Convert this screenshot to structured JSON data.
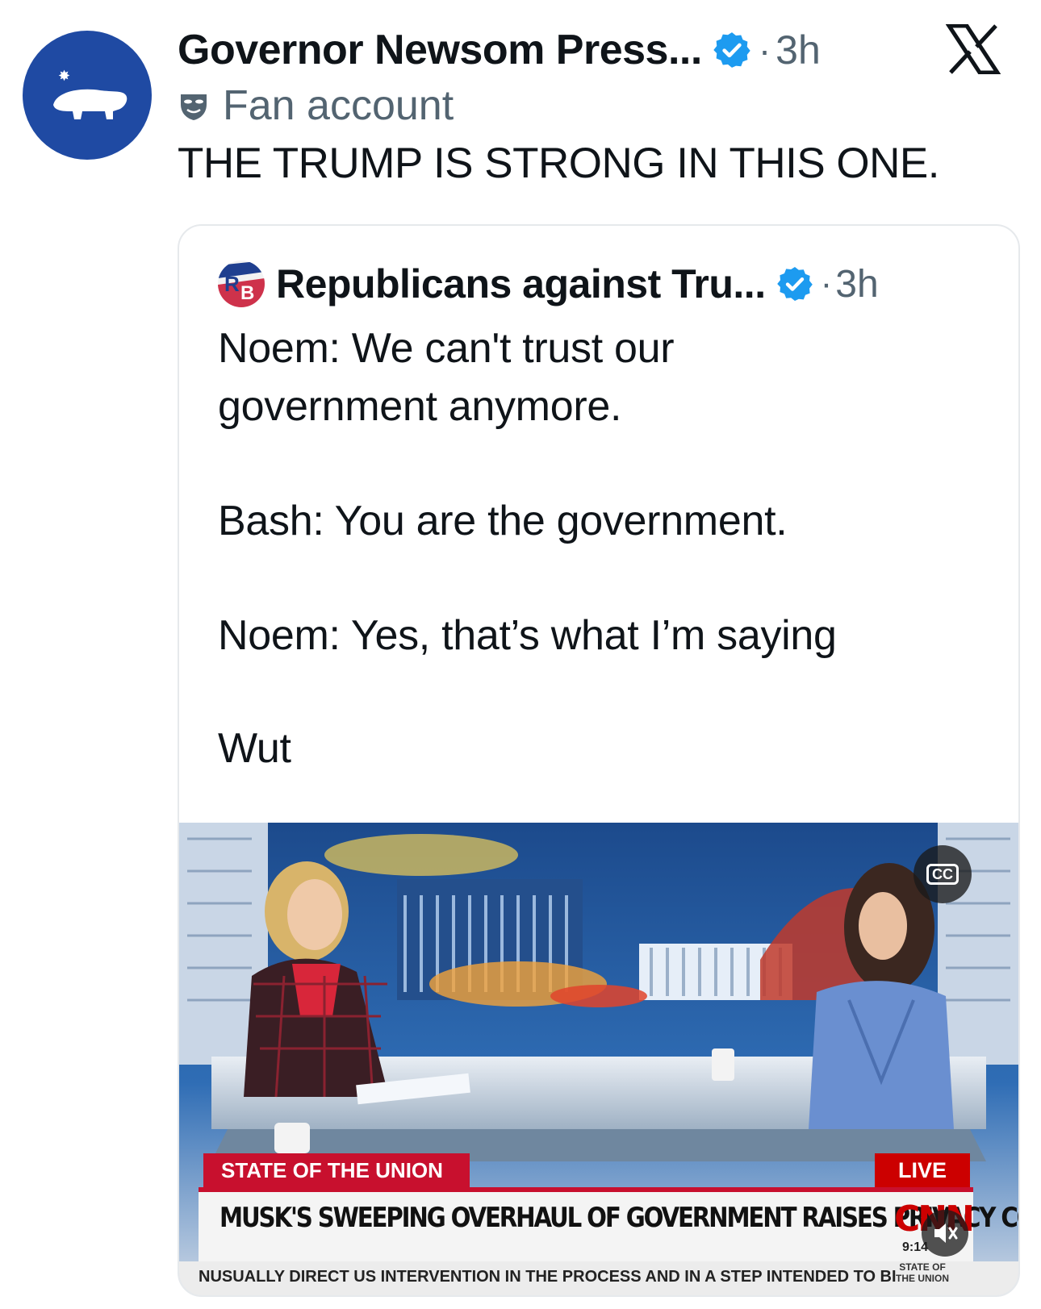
{
  "tweet": {
    "display_name": "Governor Newsom Press...",
    "dot": "·",
    "time": "3h",
    "badge_label": "Fan account",
    "text": "THE TRUMP IS STRONG IN THIS ONE.",
    "avatar_icon": "hippo-icon"
  },
  "quoted_tweet": {
    "avatar_text": "RB",
    "display_name": "Republicans against Tru...",
    "dot": "·",
    "time": "3h",
    "lines": [
      "Noem: We can't trust our",
      "government anymore.",
      "Bash: You are the government.",
      "Noem: Yes, that’s what I’m saying",
      "Wut"
    ]
  },
  "media": {
    "cc_label": "CC",
    "show_label": "STATE OF THE UNION",
    "live_label": "LIVE",
    "headline": "MUSK'S SWEEPING OVERHAUL OF GOVERNMENT RAISES PRIVACY CONCERNS",
    "network": "CNN",
    "clock": "9:14",
    "ticker": "NUSUALLY DIRECT US INTERVENTION IN THE PROCESS AND IN A STEP INTENDED TO BI",
    "ticker_logo_line1": "STATE OF",
    "ticker_logo_line2": "THE UNION"
  },
  "colors": {
    "verified": "#1d9bf0",
    "avatar_bg": "#1f4aa3",
    "secondary_text": "#536471",
    "cnn_red": "#cc0000"
  },
  "icons": [
    "hippo-icon",
    "verified-badge-icon",
    "x-logo-icon",
    "fan-mask-icon",
    "closed-captions-icon",
    "mute-icon"
  ]
}
